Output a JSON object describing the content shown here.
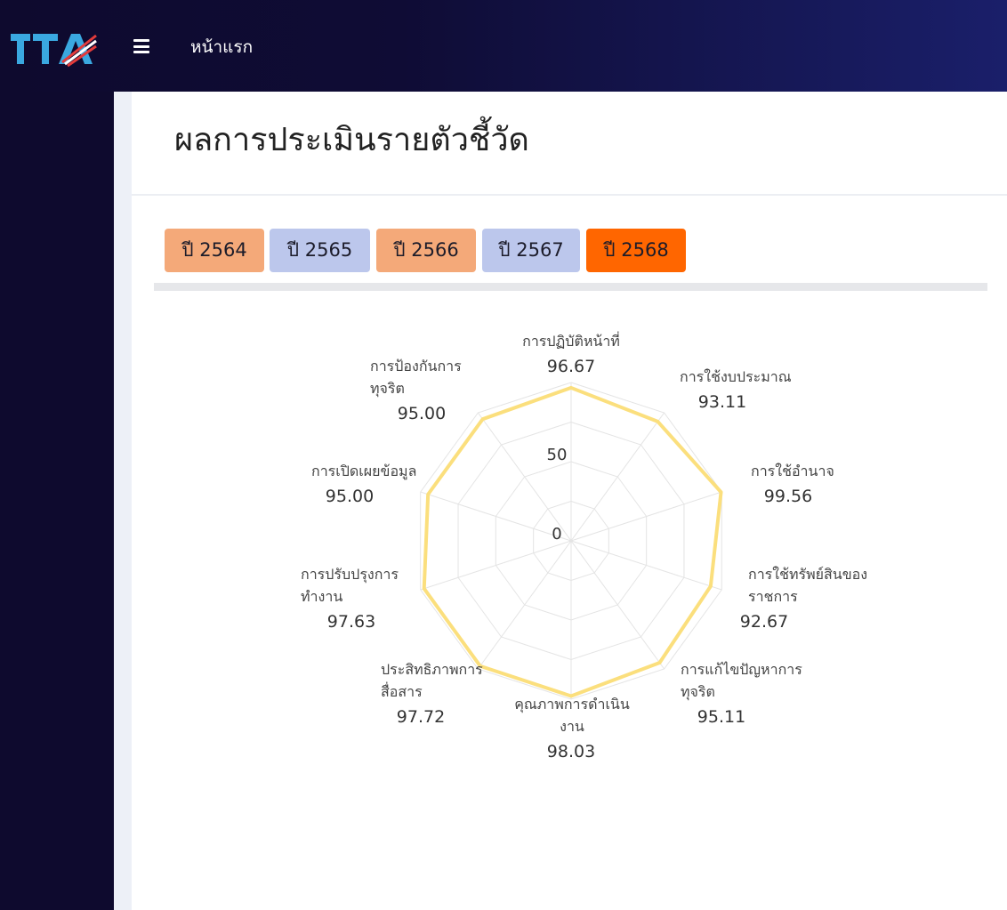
{
  "header": {
    "logo_text": "ITA",
    "home_label": "หน้าแรก"
  },
  "page": {
    "title": "ผลการประเมินรายตัวชี้วัด"
  },
  "year_tabs": [
    {
      "label": "ปี 2564",
      "color": "#f4a979"
    },
    {
      "label": "ปี 2565",
      "color": "#bcc7ec"
    },
    {
      "label": "ปี 2566",
      "color": "#f4a979"
    },
    {
      "label": "ปี 2567",
      "color": "#bcc7ec"
    },
    {
      "label": "ปี 2568",
      "color": "#ff6600",
      "selected": true
    }
  ],
  "colors": {
    "series": "#fbdf7d",
    "grid": "#e4e4e4",
    "topbar": "#0e0a2e"
  },
  "chart_data": {
    "type": "radar",
    "categories": [
      "การปฏิบัติหน้าที่",
      "การใช้งบประมาณ",
      "การใช้อำนาจ",
      "การใช้ทรัพย์สินของราชการ",
      "การแก้ไขปัญหาการทุจริต",
      "คุณภาพการดำเนินงาน",
      "ประสิทธิภาพการสื่อสาร",
      "การปรับปรุงการทำงาน",
      "การเปิดเผยข้อมูล",
      "การป้องกันการทุจริต"
    ],
    "category_lines": [
      [
        "การปฏิบัติหน้าที่"
      ],
      [
        "การใช้งบประมาณ"
      ],
      [
        "การใช้อำนาจ"
      ],
      [
        "การใช้ทรัพย์สินของ",
        "ราชการ"
      ],
      [
        "การแก้ไขปัญหาการ",
        "ทุจริต"
      ],
      [
        "คุณภาพการดำเนิน",
        "งาน"
      ],
      [
        "ประสิทธิภาพการ",
        "สื่อสาร"
      ],
      [
        "การปรับปรุงการ",
        "ทำงาน"
      ],
      [
        "การเปิดเผยข้อมูล"
      ],
      [
        "การป้องกันการ",
        "ทุจริต"
      ]
    ],
    "values": [
      96.67,
      93.11,
      99.56,
      92.67,
      95.11,
      98.03,
      97.72,
      97.63,
      95.0,
      95.0
    ],
    "value_labels": [
      "96.67",
      "93.11",
      "99.56",
      "92.67",
      "95.11",
      "98.03",
      "97.72",
      "97.63",
      "95.00",
      "95.00"
    ],
    "r_ticks": [
      0,
      50
    ],
    "r_tick_labels": [
      "0",
      "50"
    ],
    "rlim": [
      0,
      100
    ],
    "grid": true,
    "legend": "none"
  }
}
